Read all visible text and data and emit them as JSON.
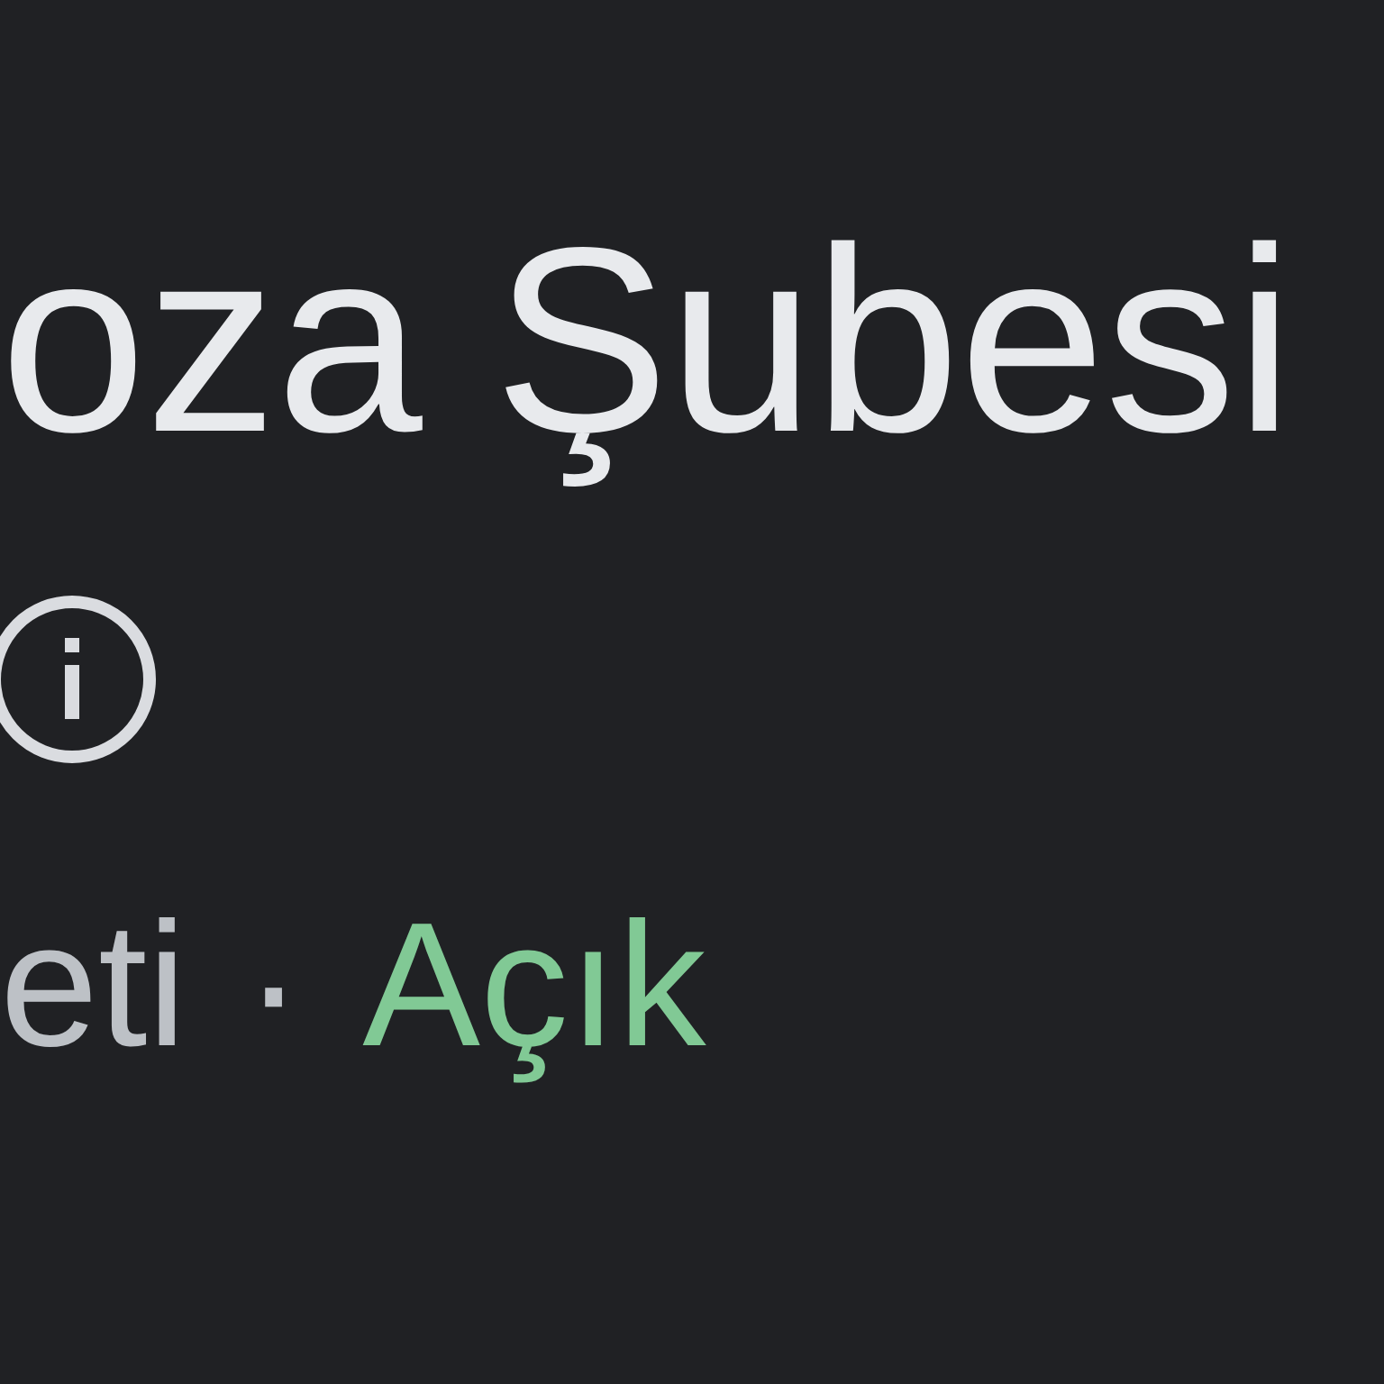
{
  "title": "oza Şubesi",
  "info_button": {
    "kind": "info"
  },
  "status_line": {
    "category": "eti",
    "separator": "·",
    "status": "Açık",
    "open": true
  }
}
